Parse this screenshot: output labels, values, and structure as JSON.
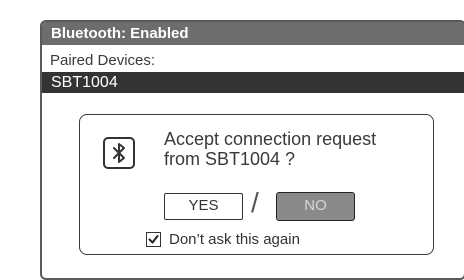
{
  "screen": {
    "title": "Bluetooth: Enabled",
    "paired_label": "Paired Devices:",
    "devices": [
      {
        "name": "SBT1004",
        "selected": true
      }
    ]
  },
  "dialog": {
    "icon": "bluetooth-icon",
    "message_line1": "Accept connection request",
    "message_line2": "from SBT1004 ?",
    "yes_label": "YES",
    "separator": "/",
    "no_label": "NO",
    "selected_option": "NO",
    "checkbox_label": "Don’t ask this again",
    "checkbox_checked": true
  },
  "colors": {
    "title_bar": "#6d6d6d",
    "selected_row": "#333333",
    "no_button_fill": "#8a8a8a"
  }
}
